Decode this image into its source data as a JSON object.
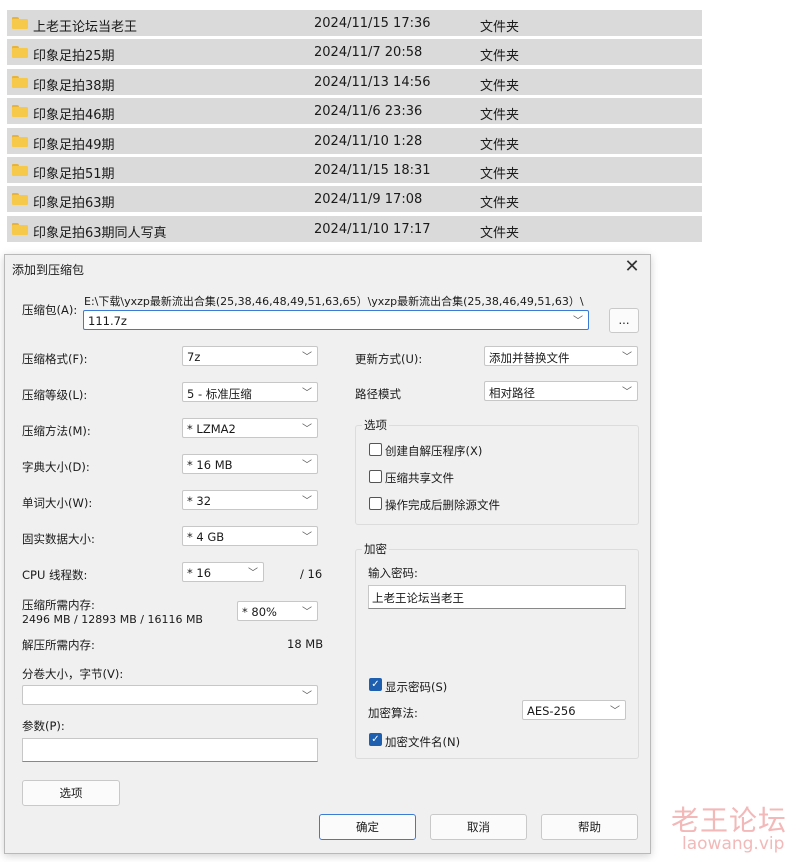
{
  "files": [
    {
      "name": "上老王论坛当老王",
      "date": "2024/11/15 17:36",
      "type": "文件夹"
    },
    {
      "name": "印象足拍25期",
      "date": "2024/11/7 20:58",
      "type": "文件夹"
    },
    {
      "name": "印象足拍38期",
      "date": "2024/11/13 14:56",
      "type": "文件夹"
    },
    {
      "name": "印象足拍46期",
      "date": "2024/11/6 23:36",
      "type": "文件夹"
    },
    {
      "name": "印象足拍49期",
      "date": "2024/11/10 1:28",
      "type": "文件夹"
    },
    {
      "name": "印象足拍51期",
      "date": "2024/11/15 18:31",
      "type": "文件夹"
    },
    {
      "name": "印象足拍63期",
      "date": "2024/11/9 17:08",
      "type": "文件夹"
    },
    {
      "name": "印象足拍63期同人写真",
      "date": "2024/11/10 17:17",
      "type": "文件夹"
    }
  ],
  "dialog": {
    "title": "添加到压缩包",
    "archive": {
      "label": "压缩包(A):",
      "path": "E:\\下载\\yxzp最新流出合集(25,38,46,48,49,51,63,65）\\yxzp最新流出合集(25,38,46,49,51,63）\\",
      "filename": "111.7z",
      "browse_label": "..."
    },
    "left": {
      "format_label": "压缩格式(F):",
      "format_value": "7z",
      "level_label": "压缩等级(L):",
      "level_value": "5 - 标准压缩",
      "method_label": "压缩方法(M):",
      "method_value": "*  LZMA2",
      "dict_label": "字典大小(D):",
      "dict_value": "*  16 MB",
      "word_label": "单词大小(W):",
      "word_value": "*  32",
      "solid_label": "固实数据大小:",
      "solid_value": "*  4 GB",
      "threads_label": "CPU 线程数:",
      "threads_value": "*  16",
      "threads_total": "/ 16",
      "mem_comp_label": "压缩所需内存:",
      "mem_comp_detail": "2496 MB / 12893 MB / 16116 MB",
      "mem_comp_value": "*  80%",
      "mem_decomp_label": "解压所需内存:",
      "mem_decomp_value": "18 MB",
      "volume_label": "分卷大小，字节(V):",
      "volume_value": "",
      "params_label": "参数(P):",
      "params_value": "",
      "options_button": "选项"
    },
    "right": {
      "update_label": "更新方式(U):",
      "update_value": "添加并替换文件",
      "pathmode_label": "路径模式",
      "pathmode_value": "相对路径",
      "options_title": "选项",
      "opt_sfx": "创建自解压程序(X)",
      "opt_shared": "压缩共享文件",
      "opt_delete": "操作完成后删除源文件",
      "enc_title": "加密",
      "password_label": "输入密码:",
      "password_value": "上老王论坛当老王",
      "show_password": "显示密码(S)",
      "enc_method_label": "加密算法:",
      "enc_method_value": "AES-256",
      "encrypt_names": "加密文件名(N)"
    },
    "buttons": {
      "ok": "确定",
      "cancel": "取消",
      "help": "帮助"
    }
  },
  "watermark": {
    "cn": "老王论坛",
    "en": "laowang.vip"
  }
}
